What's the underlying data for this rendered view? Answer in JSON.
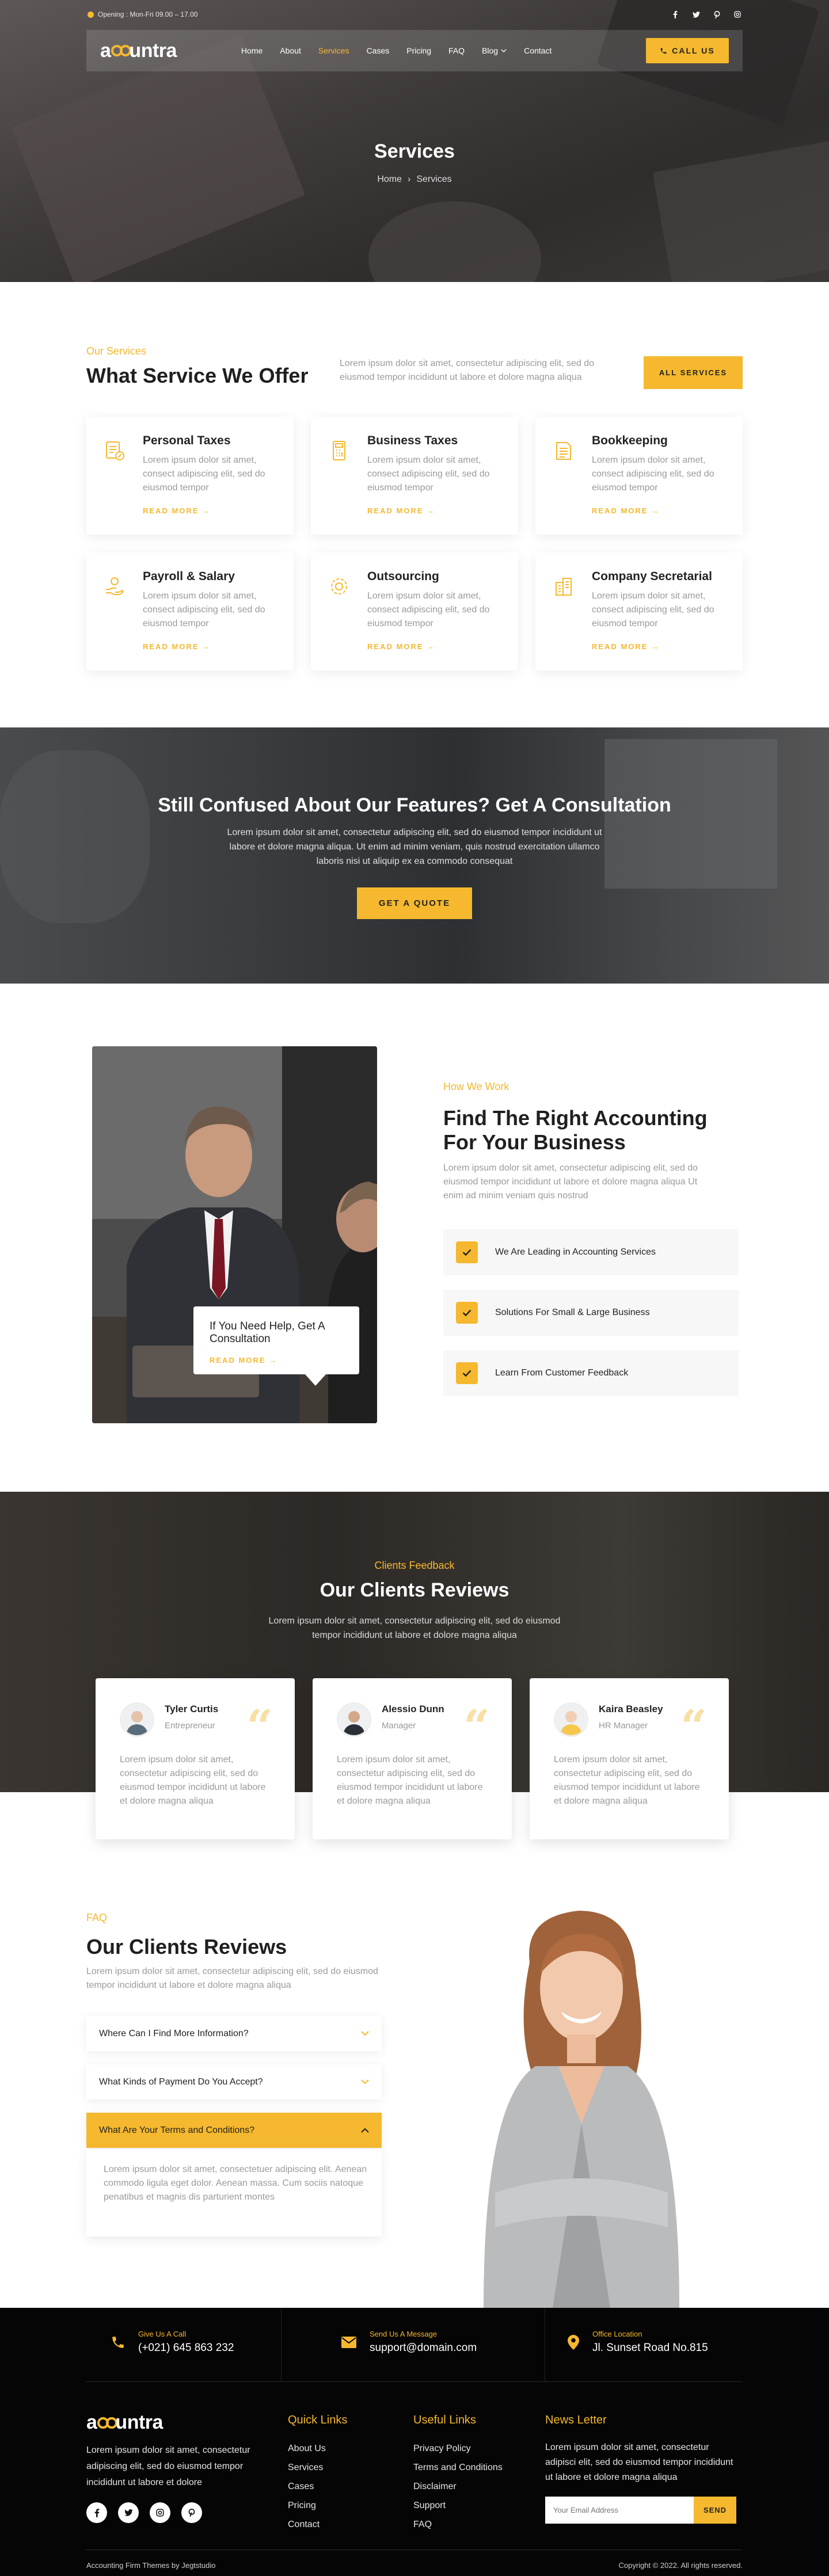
{
  "colors": {
    "accent": "#F5B82E",
    "dark": "#050505"
  },
  "topbar": {
    "opening": "Opening : Mon-Fri 09.00 – 17.00",
    "socials": [
      "facebook-icon",
      "twitter-icon",
      "pinterest-icon",
      "instagram-icon"
    ]
  },
  "nav": {
    "logo_pre": "a",
    "logo_post": "untra",
    "items": [
      "Home",
      "About",
      "Services",
      "Cases",
      "Pricing",
      "FAQ",
      "Blog",
      "Contact"
    ],
    "active": "Services",
    "call_label": "CALL US"
  },
  "hero": {
    "title": "Services",
    "breadcrumb_home": "Home",
    "breadcrumb_current": "Services"
  },
  "services": {
    "eyebrow": "Our Services",
    "title": "What Service We Offer",
    "desc": "Lorem ipsum dolor sit amet, consectetur adipiscing elit, sed do eiusmod tempor incididunt ut labore et dolore magna aliqua",
    "button": "ALL SERVICES",
    "read_more": "READ MORE",
    "items": [
      {
        "title": "Personal Taxes",
        "icon": "tax-document-icon",
        "text": "Lorem ipsum dolor sit amet, consect adipiscing elit, sed do eiusmod tempor"
      },
      {
        "title": "Business Taxes",
        "icon": "calculator-icon",
        "text": "Lorem ipsum dolor sit amet, consect adipiscing elit, sed do eiusmod tempor"
      },
      {
        "title": "Bookkeeping",
        "icon": "ledger-icon",
        "text": "Lorem ipsum dolor sit amet, consect adipiscing elit, sed do eiusmod tempor"
      },
      {
        "title": "Payroll & Salary",
        "icon": "coins-hand-icon",
        "text": "Lorem ipsum dolor sit amet, consect adipiscing elit, sed do eiusmod tempor"
      },
      {
        "title": "Outsourcing",
        "icon": "gear-icon",
        "text": "Lorem ipsum dolor sit amet, consect adipiscing elit, sed do eiusmod tempor"
      },
      {
        "title": "Company Secretarial",
        "icon": "building-icon",
        "text": "Lorem ipsum dolor sit amet, consect adipiscing elit, sed do eiusmod tempor"
      }
    ]
  },
  "consult": {
    "title": "Still Confused About Our Features? Get A Consultation",
    "text": "Lorem ipsum dolor sit amet, consectetur adipiscing elit, sed do eiusmod tempor incididunt ut labore et dolore magna aliqua. Ut enim ad minim veniam, quis nostrud exercitation ullamco laboris nisi ut aliquip ex ea commodo consequat",
    "button": "GET A QUOTE"
  },
  "how": {
    "eyebrow": "How We Work",
    "title": "Find The Right Accounting For Your Business",
    "text": "Lorem ipsum dolor sit amet, consectetur adipiscing elit, sed do eiusmod tempor incididunt ut labore et dolore magna aliqua Ut enim ad minim veniam quis nostrud",
    "checks": [
      "We Are Leading in Accounting Services",
      "Solutions For Small & Large Business",
      "Learn From Customer Feedback"
    ],
    "help_title": "If You Need Help, Get A Consultation",
    "help_link": "READ MORE"
  },
  "reviews": {
    "eyebrow": "Clients Feedback",
    "title": "Our Clients Reviews",
    "text": "Lorem ipsum dolor sit amet, consectetur adipiscing elit, sed do eiusmod tempor incididunt ut labore et dolore magna aliqua",
    "items": [
      {
        "name": "Tyler Curtis",
        "role": "Entrepreneur",
        "text": "Lorem ipsum dolor sit amet, consectetur adipiscing elit, sed do eiusmod tempor incididunt ut labore et dolore magna aliqua"
      },
      {
        "name": "Alessio Dunn",
        "role": "Manager",
        "text": "Lorem ipsum dolor sit amet, consectetur adipiscing elit, sed do eiusmod tempor incididunt ut labore et dolore magna aliqua"
      },
      {
        "name": "Kaira Beasley",
        "role": "HR Manager",
        "text": "Lorem ipsum dolor sit amet, consectetur adipiscing elit, sed do eiusmod tempor incididunt ut labore et dolore magna aliqua"
      }
    ]
  },
  "faq": {
    "eyebrow": "FAQ",
    "title": "Our Clients Reviews",
    "text": "Lorem ipsum dolor sit amet, consectetur adipiscing elit, sed do eiusmod tempor incididunt ut labore et dolore magna aliqua",
    "items": [
      "Where Can I Find More Information?",
      "What Kinds of Payment Do You Accept?",
      "What Are Your Terms and Conditions?"
    ],
    "answer": "Lorem ipsum dolor sit amet, consectetuer adipiscing elit. Aenean commodo ligula eget dolor. Aenean massa. Cum sociis natoque penatibus et magnis dis parturient montes"
  },
  "footer": {
    "contacts": [
      {
        "label": "Give Us A Call",
        "value": "(+021) 645 863 232"
      },
      {
        "label": "Send Us A Message",
        "value": "support@domain.com"
      },
      {
        "label": "Office Location",
        "value": "Jl. Sunset Road No.815"
      }
    ],
    "about": "Lorem ipsum dolor sit amet, consectetur adipiscing elit, sed do eiusmod tempor incididunt ut labore et dolore",
    "quick_title": "Quick Links",
    "quick": [
      "About Us",
      "Services",
      "Cases",
      "Pricing",
      "Contact"
    ],
    "useful_title": "Useful Links",
    "useful": [
      "Privacy Policy",
      "Terms and Conditions",
      "Disclaimer",
      "Support",
      "FAQ"
    ],
    "news_title": "News Letter",
    "news_text": "Lorem ipsum dolor sit amet, consectetur adipisci elit, sed do eiusmod tempor incididunt ut labore et dolore magna aliqua",
    "email_placeholder": "Your Email Address",
    "send": "SEND",
    "credit": "Accounting Firm Themes by Jegtstudio",
    "copyright": "Copyright © 2022. All rights reserved."
  }
}
